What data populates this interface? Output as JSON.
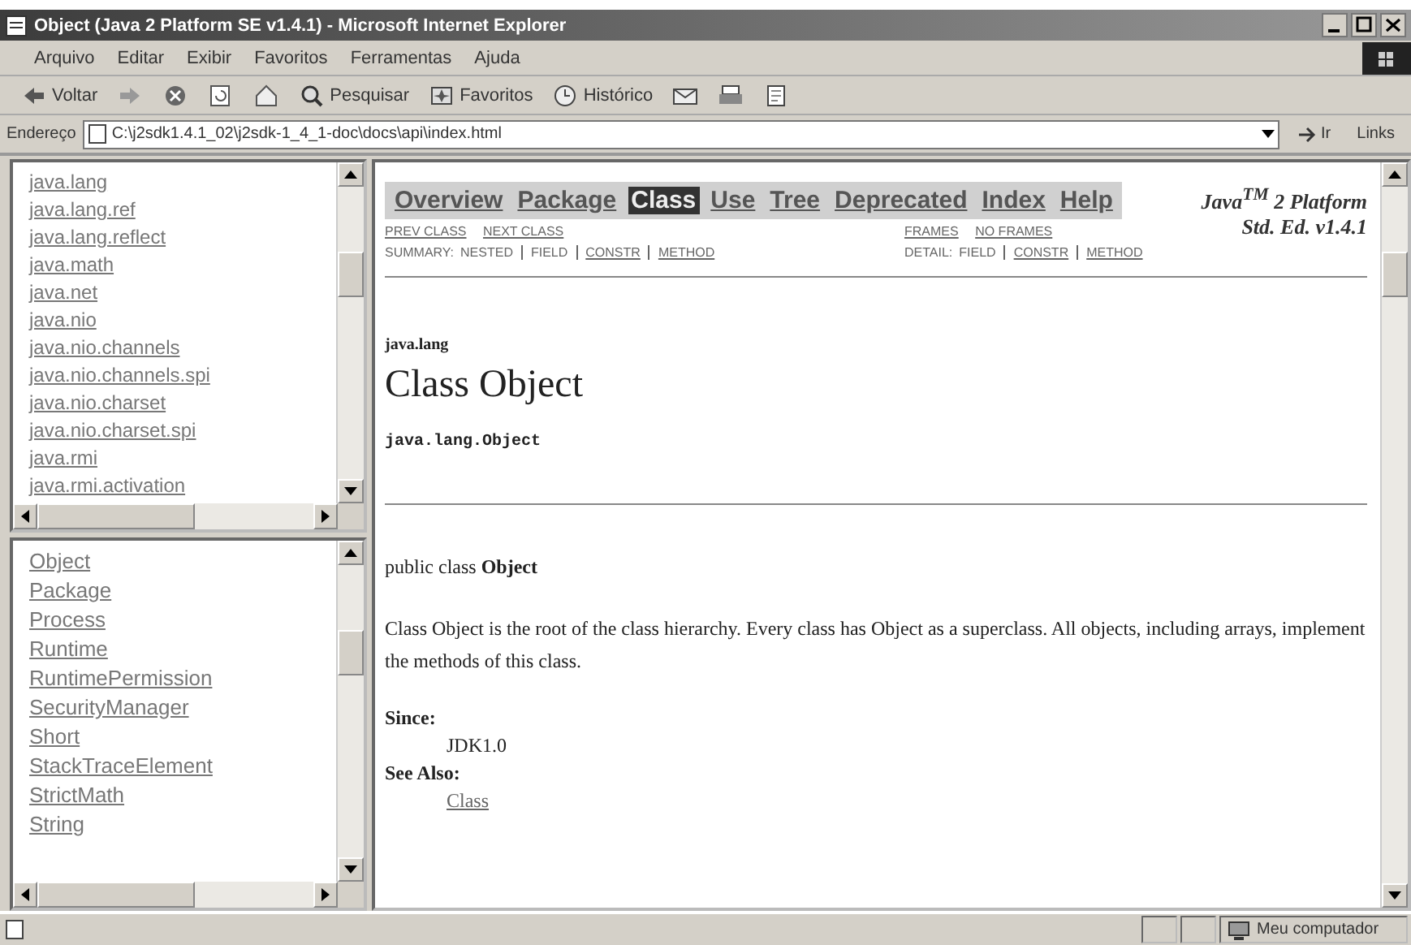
{
  "window": {
    "title": "Object (Java 2 Platform SE v1.4.1) - Microsoft Internet Explorer"
  },
  "menu": [
    "Arquivo",
    "Editar",
    "Exibir",
    "Favoritos",
    "Ferramentas",
    "Ajuda"
  ],
  "toolbar": [
    {
      "kind": "back",
      "label": "Voltar"
    },
    {
      "kind": "forward"
    },
    {
      "kind": "stop"
    },
    {
      "kind": "refresh"
    },
    {
      "kind": "home"
    },
    {
      "kind": "search",
      "label": "Pesquisar"
    },
    {
      "kind": "favorites",
      "label": "Favoritos"
    },
    {
      "kind": "history",
      "label": "Histórico"
    },
    {
      "kind": "mail"
    },
    {
      "kind": "print"
    },
    {
      "kind": "edit"
    }
  ],
  "address": {
    "label": "Endereço",
    "value": "C:\\j2sdk1.4.1_02\\j2sdk-1_4_1-doc\\docs\\api\\index.html",
    "go": "Ir",
    "links": "Links"
  },
  "packages": [
    "java.lang",
    "java.lang.ref",
    "java.lang.reflect",
    "java.math",
    "java.net",
    "java.nio",
    "java.nio.channels",
    "java.nio.channels.spi",
    "java.nio.charset",
    "java.nio.charset.spi",
    "java.rmi",
    "java.rmi.activation"
  ],
  "classes": [
    "Object",
    "Package",
    "Process",
    "Runtime",
    "RuntimePermission",
    "SecurityManager",
    "Short",
    "StackTraceElement",
    "StrictMath",
    "String"
  ],
  "doc": {
    "nav": [
      {
        "label": "Overview",
        "selected": false
      },
      {
        "label": "Package",
        "selected": false
      },
      {
        "label": "Class",
        "selected": true
      },
      {
        "label": "Use",
        "selected": false
      },
      {
        "label": "Tree",
        "selected": false
      },
      {
        "label": "Deprecated",
        "selected": false
      },
      {
        "label": "Index",
        "selected": false
      },
      {
        "label": "Help",
        "selected": false
      }
    ],
    "platform": [
      "Java$^{TM}$ 2 Platform",
      "Std. Ed. v1.4.1"
    ],
    "prev_next": [
      "PREV CLASS",
      "NEXT CLASS"
    ],
    "frames": [
      "FRAMES",
      "NO FRAMES"
    ],
    "summary": {
      "label": "SUMMARY:",
      "items": [
        {
          "text": "NESTED",
          "link": false
        },
        {
          "text": "FIELD",
          "link": false
        },
        {
          "text": "CONSTR",
          "link": true
        },
        {
          "text": "METHOD",
          "link": true
        }
      ]
    },
    "detail": {
      "label": "DETAIL:",
      "items": [
        {
          "text": "FIELD",
          "link": false
        },
        {
          "text": "CONSTR",
          "link": true
        },
        {
          "text": "METHOD",
          "link": true
        }
      ]
    },
    "package": "java.lang",
    "heading": "Class Object",
    "hierarchy": "java.lang.Object",
    "declaration": "public class **Object**",
    "description": "Class Object is the root of the class hierarchy. Every class has Object as a superclass. All objects, including arrays, implement the methods of this class.",
    "since_label": "Since:",
    "since": "JDK1.0",
    "see_label": "See Also:",
    "see": "Class"
  },
  "status": {
    "text": "Meu computador"
  }
}
